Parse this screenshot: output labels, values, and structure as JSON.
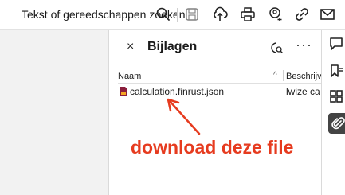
{
  "toolbar": {
    "search_tools_label": "Tekst of gereedschappen zoeken",
    "icons": [
      "search-icon",
      "save-icon",
      "upload-icon",
      "print-icon",
      "add-user-icon",
      "link-icon",
      "mail-icon"
    ]
  },
  "panel": {
    "close_label": "×",
    "title": "Bijlagen",
    "more_label": "···",
    "columns": {
      "name": "Naam",
      "sort_indicator": "^",
      "description": "Beschrijving"
    },
    "files": [
      {
        "name": "calculation.finrust.json",
        "description": "lwize ca"
      }
    ]
  },
  "annotation": {
    "text": "download deze file",
    "color": "#e63b1f"
  },
  "sidebar_right": {
    "icons": [
      "comment-icon",
      "bookmark-icon",
      "thumbnails-icon",
      "attachment-icon"
    ],
    "active": "attachment-icon"
  },
  "colors": {
    "accent": "#e63b1f",
    "doc_background": "#f2f2f2",
    "active_sidebar": "#444444"
  }
}
